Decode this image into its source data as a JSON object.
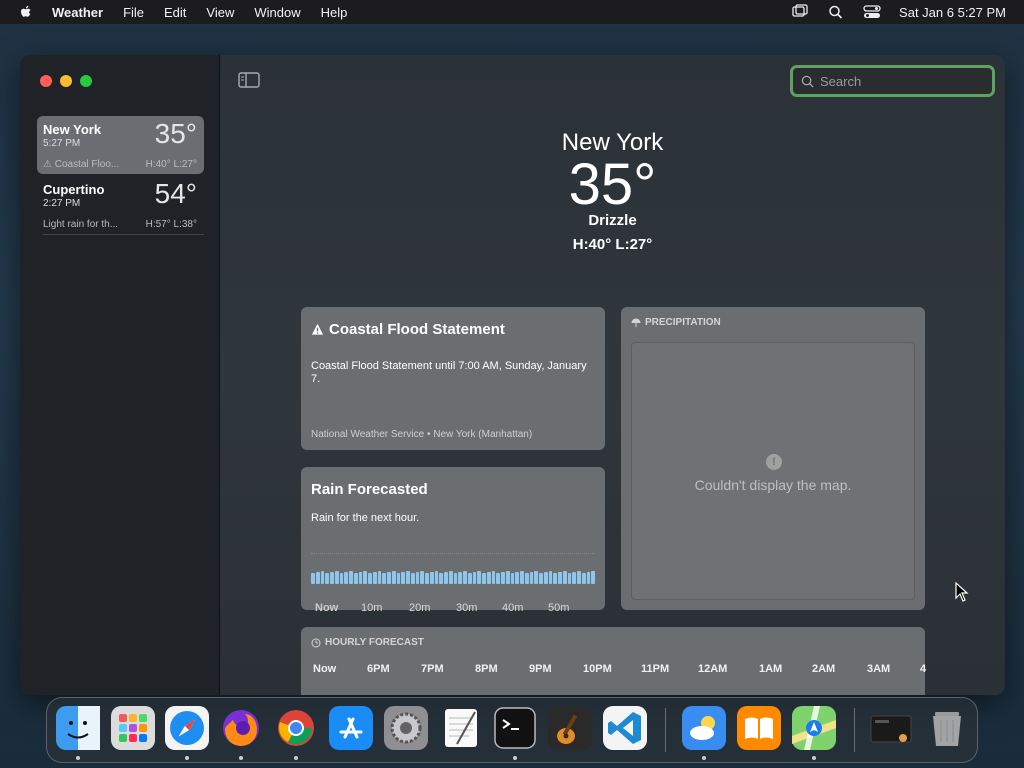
{
  "menubar": {
    "app_name": "Weather",
    "items": [
      "File",
      "Edit",
      "View",
      "Window",
      "Help"
    ],
    "datetime": "Sat Jan 6  5:27 PM"
  },
  "sidebar": {
    "cities": [
      {
        "name": "New York",
        "time": "5:27 PM",
        "temp": "35°",
        "condition": "Coastal Floo...",
        "hl": "H:40°  L:27°"
      },
      {
        "name": "Cupertino",
        "time": "2:27 PM",
        "temp": "54°",
        "condition": "Light rain for th...",
        "hl": "H:57°  L:38°"
      }
    ]
  },
  "search": {
    "placeholder": "Search"
  },
  "current": {
    "city": "New York",
    "temp": "35°",
    "condition": "Drizzle",
    "hl": "H:40°  L:27°"
  },
  "flood": {
    "title": "Coastal Flood Statement",
    "body": "Coastal Flood Statement until 7:00 AM, Sunday, January 7.",
    "source": "National Weather Service • New York (Manhattan)"
  },
  "rain": {
    "title": "Rain Forecasted",
    "body": "Rain for the next hour.",
    "ticks": [
      "Now",
      "10m",
      "20m",
      "30m",
      "40m",
      "50m"
    ]
  },
  "precip": {
    "header": "PRECIPITATION",
    "message": "Couldn't display the map."
  },
  "hourly": {
    "header": "HOURLY FORECAST",
    "hours": [
      "Now",
      "6PM",
      "7PM",
      "8PM",
      "9PM",
      "10PM",
      "11PM",
      "12AM",
      "1AM",
      "2AM",
      "3AM",
      "4"
    ]
  },
  "colors": {
    "accent_green": "#5fa15f",
    "rain_bar": "#8fc6ec"
  },
  "dock": {
    "apps": [
      "finder-icon",
      "launchpad-icon",
      "safari-icon",
      "firefox-icon",
      "chrome-icon",
      "app-store-icon",
      "system-settings-icon",
      "textedit-icon",
      "terminal-icon",
      "garageband-icon",
      "vscode-icon",
      "weather-icon",
      "books-icon",
      "maps-icon",
      "preview-icon",
      "trash-icon"
    ]
  }
}
